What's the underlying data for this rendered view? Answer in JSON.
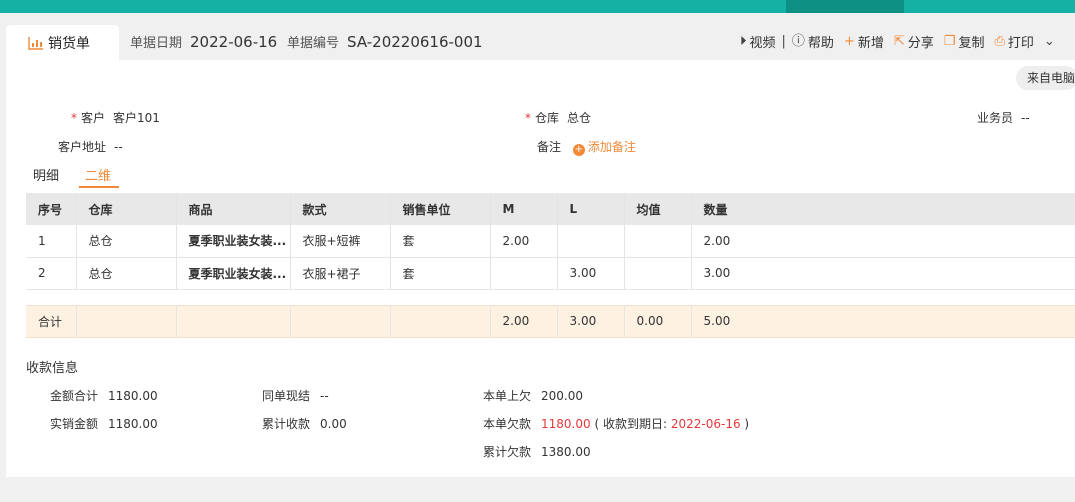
{
  "header": {
    "doc_type": "销货单",
    "date_label": "单据日期",
    "date_value": "2022-06-16",
    "no_label": "单据编号",
    "no_value": "SA-20220616-001"
  },
  "actions": {
    "video": "视频",
    "separator": "|",
    "help": "帮助",
    "new": "新增",
    "share": "分享",
    "copy": "复制",
    "print": "打印"
  },
  "source_button": "来自电脑",
  "form": {
    "customer_label": "客户",
    "customer_value": "客户101",
    "warehouse_label": "仓库",
    "warehouse_value": "总仓",
    "salesman_label": "业务员",
    "salesman_value": "--",
    "address_label": "客户地址",
    "address_value": "--",
    "remark_label": "备注",
    "remark_add": "添加备注",
    "required_mark": "*"
  },
  "tabs": [
    "明细",
    "二维"
  ],
  "table": {
    "headers": [
      "序号",
      "仓库",
      "商品",
      "款式",
      "销售单位",
      "M",
      "L",
      "均值",
      "数量"
    ],
    "rows": [
      [
        "1",
        "总仓",
        "夏季职业装女装...",
        "衣服+短裤",
        "套",
        "2.00",
        "",
        "",
        "2.00"
      ],
      [
        "2",
        "总仓",
        "夏季职业装女装...",
        "衣服+裙子",
        "套",
        "",
        "3.00",
        "",
        "3.00"
      ]
    ],
    "total": [
      "合计",
      "",
      "",
      "",
      "",
      "2.00",
      "3.00",
      "0.00",
      "5.00"
    ]
  },
  "payment": {
    "title": "收款信息",
    "amount_total_label": "金额合计",
    "amount_total_value": "1180.00",
    "actual_label": "实销金额",
    "actual_value": "1180.00",
    "settle_label": "同单现结",
    "settle_value": "--",
    "received_label": "累计收款",
    "received_value": "0.00",
    "prev_owed_label": "本单上欠",
    "prev_owed_value": "200.00",
    "owed_label": "本单欠款",
    "owed_value": "1180.00",
    "due_prefix": "( 收款到期日:",
    "due_date": "2022-06-16",
    "due_suffix": ")",
    "total_owed_label": "累计欠款",
    "total_owed_value": "1380.00"
  },
  "colors": {
    "brand": "#14b1a5",
    "accent": "#f08a38",
    "danger": "#e4393c"
  }
}
